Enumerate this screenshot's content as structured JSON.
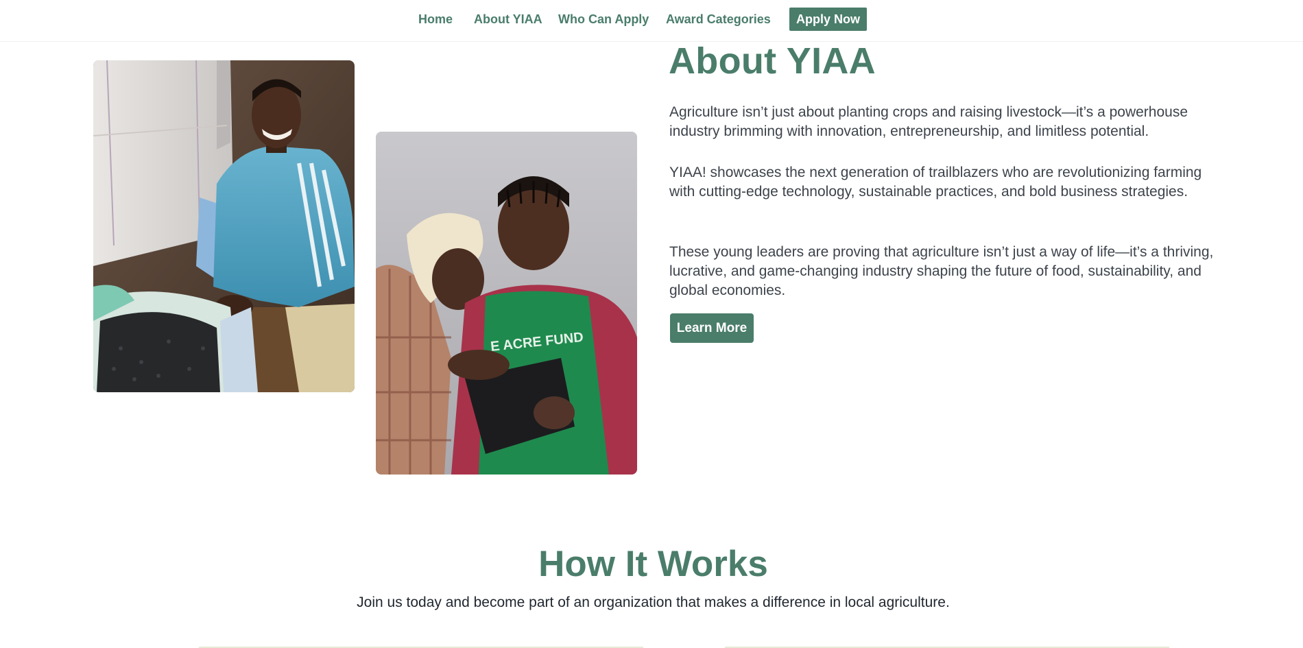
{
  "nav": {
    "items": [
      {
        "label": "Home"
      },
      {
        "label": "About YIAA"
      },
      {
        "label": "Who Can Apply"
      },
      {
        "label": "Award Categories"
      }
    ],
    "cta_label": "Apply Now"
  },
  "colors": {
    "brand_green": "#4a7d6a",
    "body_text": "#3d434b",
    "background": "#ffffff"
  },
  "about": {
    "title": "About YIAA",
    "paragraphs": [
      "Agriculture isn’t just about planting crops and raising livestock—it’s a powerhouse industry brimming with innovation, entrepreneurship, and limitless potential.",
      "YIAA! showcases the next generation of trailblazers who are revolutionizing farming with cutting-edge technology, sustainable practices, and bold business strategies.",
      "These young leaders are proving that agriculture isn’t just a way of life—it’s a thriving, lucrative, and game-changing industry shaping the future of food, sustainability, and global economies."
    ],
    "button_label": "Learn More"
  },
  "how_it_works": {
    "title": "How It Works",
    "subtitle": "Join us today and become part of an organization that makes a difference in local agriculture."
  },
  "photos": {
    "photo_2_shirt_text": "E ACRE FUND"
  }
}
